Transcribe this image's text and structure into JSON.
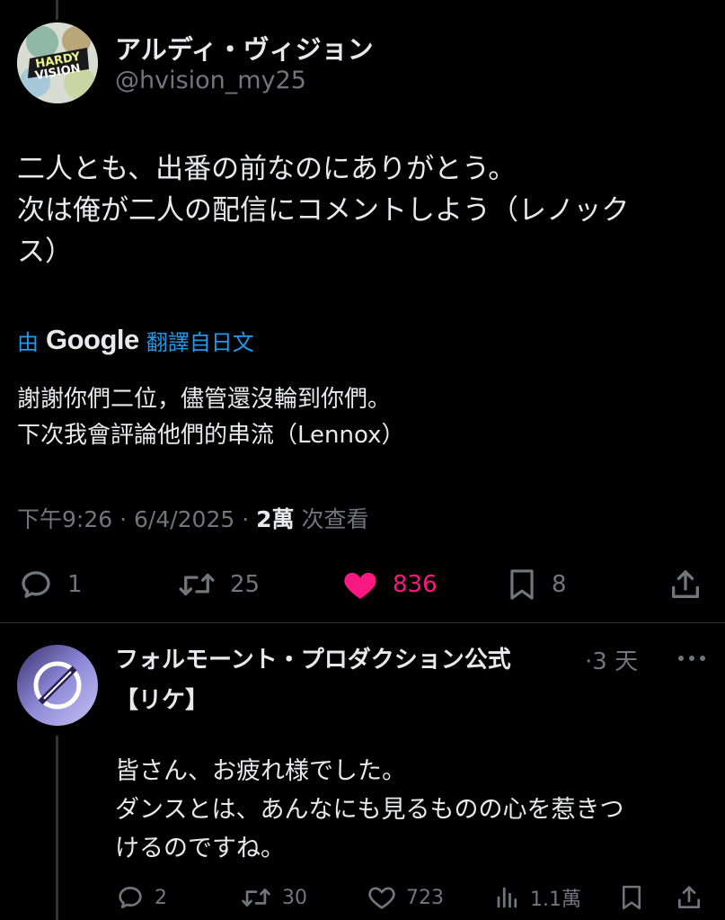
{
  "tweet": {
    "display_name": "アルディ・ヴィジョン",
    "handle": "@hvision_my25",
    "avatar_text": [
      "HARDY",
      "VISION"
    ],
    "text_lines": [
      "二人とも、出番の前なのにありがとう。",
      "次は俺が二人の配信にコメントしよう（レノック",
      "ス）"
    ],
    "translate_prefix": "由",
    "translate_brand": "Google",
    "translate_suffix": "翻譯自日文",
    "translation_lines": [
      "謝謝你們二位，儘管還沒輪到你們。",
      "下次我會評論他們的串流（Lennox）"
    ],
    "time": "下午9:26",
    "date": "6/4/2025",
    "views_count": "2萬",
    "views_label": "次查看",
    "replies": "1",
    "retweets": "25",
    "likes": "836",
    "bookmarks": "8",
    "icons": [
      "reply-icon",
      "retweet-icon",
      "heart-icon",
      "bookmark-icon",
      "share-icon"
    ],
    "like_color": "#f91880"
  },
  "reply": {
    "display_name": "フォルモーント・プロダクション公式",
    "time": "3 天",
    "tag": "【リケ】",
    "text_lines": [
      "皆さん、お疲れ様でした。",
      "ダンスとは、あんなにも見るものの心を惹きつ",
      "けるのですね。"
    ],
    "replies": "2",
    "retweets": "30",
    "likes": "723",
    "views": "1.1萬",
    "icons": [
      "more-icon",
      "reply-icon",
      "retweet-icon",
      "heart-icon",
      "views-icon",
      "bookmark-icon",
      "share-icon"
    ]
  },
  "colors": {
    "background": "#000000",
    "text": "#e7e9ea",
    "muted": "#71767b",
    "link": "#1d9bf0",
    "like": "#f91880"
  }
}
